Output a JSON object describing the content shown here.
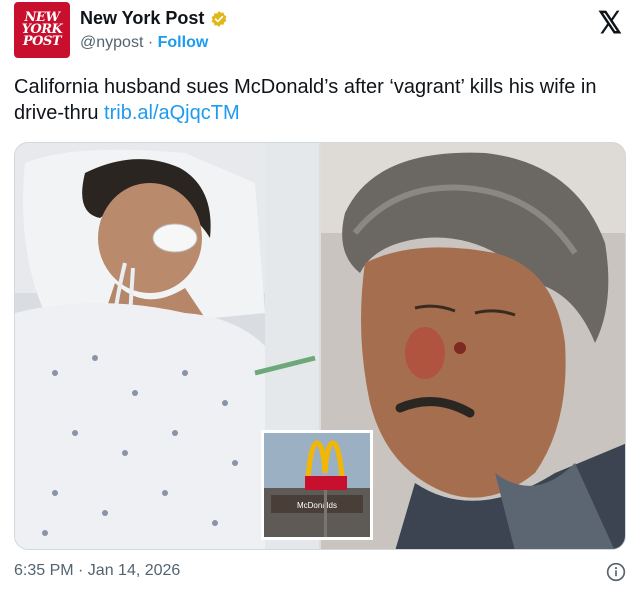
{
  "account": {
    "logo_lines": [
      "NEW",
      "YORK",
      "POST"
    ],
    "name": "New York Post",
    "handle": "@nypost",
    "separator": "·",
    "follow_label": "Follow"
  },
  "tweet": {
    "text": "California husband sues McDonald’s after ‘vagrant’ kills his wife in drive-thru ",
    "link": "trib.al/aQjqcTM"
  },
  "media": {
    "inset_sign_text": "McDonalds"
  },
  "meta": {
    "timestamp": "6:35 PM · Jan 14, 2026"
  },
  "colors": {
    "brand": "#c8102e",
    "link": "#1d9bf0",
    "verified": "#e2b719"
  },
  "icons": {
    "verified": "verified-badge-icon",
    "x_logo": "x-logo-icon",
    "info": "info-icon"
  }
}
